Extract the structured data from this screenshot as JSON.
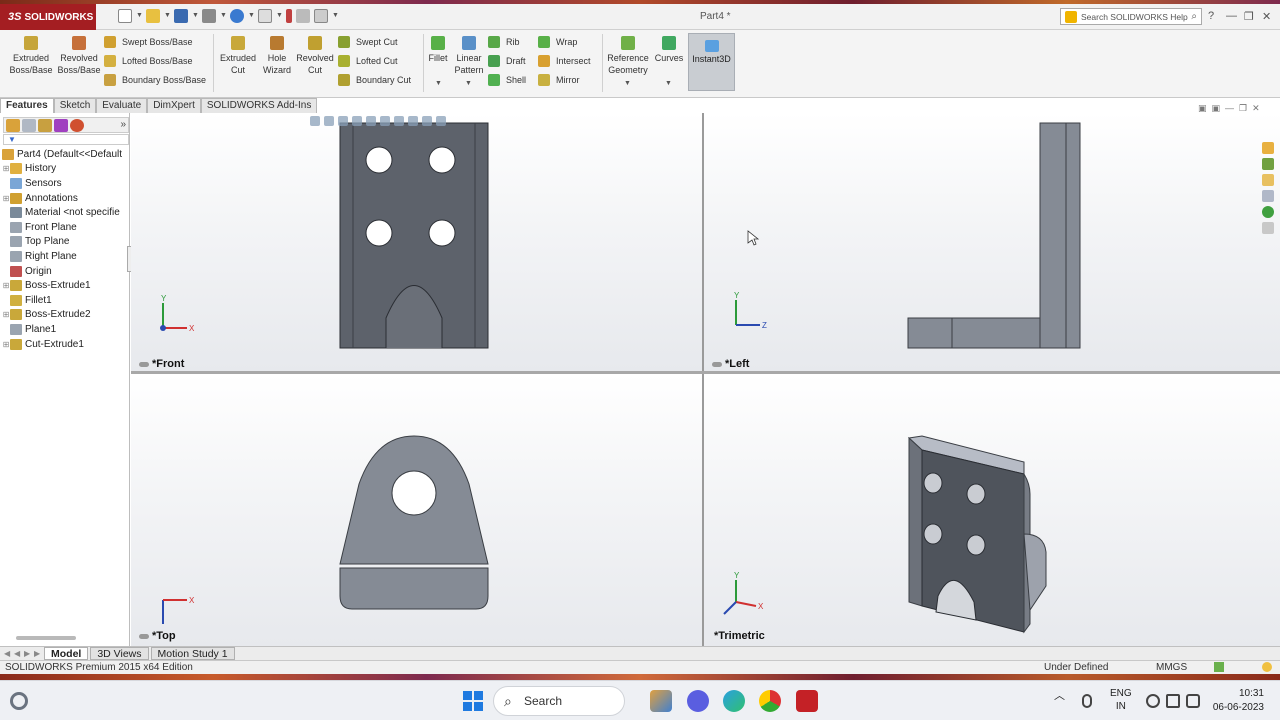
{
  "app": {
    "brand": "SOLIDWORKS",
    "document_title": "Part4 *",
    "help_search_placeholder": "Search SOLIDWORKS Help"
  },
  "command_manager": {
    "extruded_boss": "Extruded Boss/Base",
    "revolved_boss": "Revolved Boss/Base",
    "swept_boss": "Swept Boss/Base",
    "lofted_boss": "Lofted Boss/Base",
    "boundary_boss": "Boundary Boss/Base",
    "extruded_cut": "Extruded Cut",
    "hole_wizard": "Hole Wizard",
    "revolved_cut": "Revolved Cut",
    "swept_cut": "Swept Cut",
    "lofted_cut": "Lofted Cut",
    "boundary_cut": "Boundary Cut",
    "fillet": "Fillet",
    "linear_pattern": "Linear Pattern",
    "rib": "Rib",
    "draft": "Draft",
    "shell": "Shell",
    "wrap": "Wrap",
    "intersect": "Intersect",
    "mirror": "Mirror",
    "reference_geometry": "Reference Geometry",
    "curves": "Curves",
    "instant3d": "Instant3D"
  },
  "tabs": [
    "Features",
    "Sketch",
    "Evaluate",
    "DimXpert",
    "SOLIDWORKS Add-Ins"
  ],
  "feature_tree": {
    "root": "Part4  (Default<<Default",
    "items": [
      {
        "label": "History",
        "expand": true,
        "color": "#e0b040"
      },
      {
        "label": "Sensors",
        "expand": false,
        "color": "#7aa6d6"
      },
      {
        "label": "Annotations",
        "expand": true,
        "color": "#d0a030"
      },
      {
        "label": "Material <not specifie",
        "expand": false,
        "color": "#7a8a9a"
      },
      {
        "label": "Front Plane",
        "expand": false,
        "color": "#9aa4b0"
      },
      {
        "label": "Top Plane",
        "expand": false,
        "color": "#9aa4b0"
      },
      {
        "label": "Right Plane",
        "expand": false,
        "color": "#9aa4b0"
      },
      {
        "label": "Origin",
        "expand": false,
        "color": "#c05050"
      },
      {
        "label": "Boss-Extrude1",
        "expand": true,
        "color": "#c9a83a"
      },
      {
        "label": "Fillet1",
        "expand": false,
        "color": "#d0b040"
      },
      {
        "label": "Boss-Extrude2",
        "expand": true,
        "color": "#c9a83a"
      },
      {
        "label": "Plane1",
        "expand": false,
        "color": "#9aa4b0"
      },
      {
        "label": "Cut-Extrude1",
        "expand": true,
        "color": "#c9a83a"
      }
    ]
  },
  "viewports": {
    "front": "*Front",
    "left": "*Left",
    "top": "*Top",
    "trimetric": "*Trimetric"
  },
  "model_tabs": [
    "Model",
    "3D Views",
    "Motion Study 1"
  ],
  "status": {
    "edition": "SOLIDWORKS Premium 2015 x64 Edition",
    "state": "Under Defined",
    "units": "MMGS"
  },
  "taskbar": {
    "search": "Search",
    "lang_line1": "ENG",
    "lang_line2": "IN",
    "time": "10:31",
    "date": "06-06-2023"
  },
  "colors": {
    "brand_red": "#a41e22",
    "part_dark": "#5d626b",
    "part_mid": "#858b95",
    "accent_blue": "#1f7ae0"
  }
}
